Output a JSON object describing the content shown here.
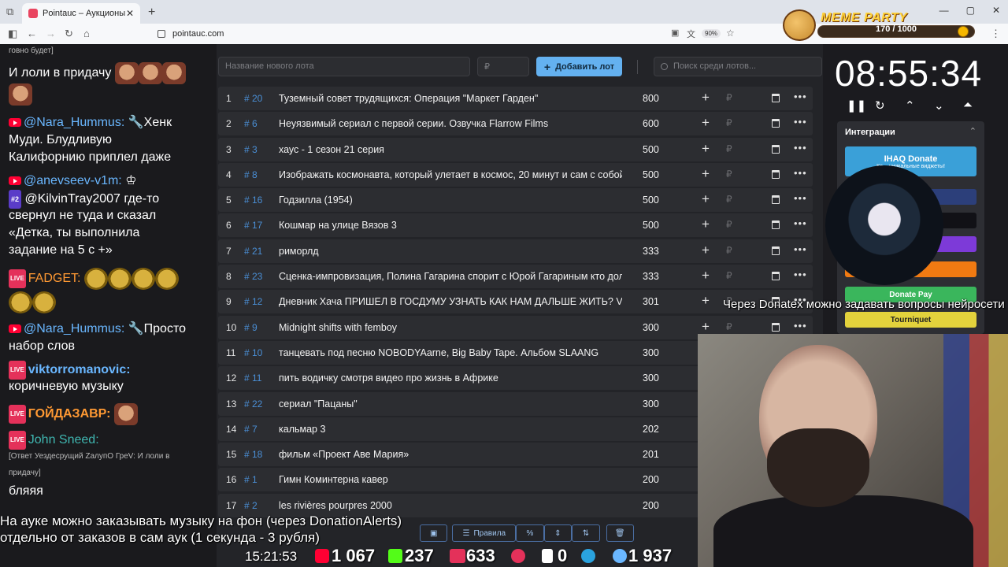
{
  "browser": {
    "tab_title": "Pointauc – Аукционы, лотереи",
    "url": "pointauc.com",
    "zoom": "90%"
  },
  "meme_party": {
    "title": "MEME PARTY",
    "progress": "170 / 1000"
  },
  "chat": {
    "lines": [
      {
        "text": "говно будет]"
      },
      {
        "text": "И лоли в придачу"
      },
      {
        "nick": "@Nara_Hummus:",
        "text": "Хенк"
      },
      {
        "text": "Муди. Блудливую"
      },
      {
        "text": "Калифорнию приплел даже"
      },
      {
        "nick": "@anevseev-v1m:"
      },
      {
        "badge": "#2",
        "text": "@KilvinTray2007 где-то"
      },
      {
        "text": "свернул не туда и сказал"
      },
      {
        "text": "«Детка, ты выполнила"
      },
      {
        "text": "задание на 5 с +»"
      },
      {
        "nick": "FADGET:"
      },
      {
        "nick": "@Nara_Hummus:",
        "text": "Просто"
      },
      {
        "text": "набор слов"
      },
      {
        "nick": "viktorromanovic:"
      },
      {
        "text": "коричневую музыку"
      },
      {
        "nick": "ГОЙДАЗАВР:"
      },
      {
        "nick": "John Sneed:"
      },
      {
        "text": "[Ответ Уездесрущий ZалупО ГреV: И лоли в"
      },
      {
        "text": "придачу]"
      },
      {
        "text": "бляяя"
      }
    ]
  },
  "app": {
    "new_lot_placeholder": "Название нового лота",
    "price_placeholder": "₽",
    "add_button": "Добавить лот",
    "search_placeholder": "Поиск среди лотов...",
    "rows": [
      {
        "idx": "1",
        "num": "# 20",
        "name": "Туземный совет трудящихся: Операция \"Маркет Гарден\"",
        "amount": "800"
      },
      {
        "idx": "2",
        "num": "# 6",
        "name": "Неуязвимый сериал с первой серии. Озвучка Flarrow Films",
        "amount": "600"
      },
      {
        "idx": "3",
        "num": "# 3",
        "name": "хаус - 1 сезон 21 серия",
        "amount": "500"
      },
      {
        "idx": "4",
        "num": "# 8",
        "name": "Изображать космонавта, который улетает в космос, 20 минут и сам с собой",
        "amount": "500"
      },
      {
        "idx": "5",
        "num": "# 16",
        "name": "Годзилла (1954)",
        "amount": "500"
      },
      {
        "idx": "6",
        "num": "# 17",
        "name": "Кошмар на улице Вязов 3",
        "amount": "500"
      },
      {
        "idx": "7",
        "num": "# 21",
        "name": "риморлд",
        "amount": "333"
      },
      {
        "idx": "8",
        "num": "# 23",
        "name": "Сценка-импровизация, Полина Гагарина спорит с Юрой Гагариным кто должен",
        "amount": "333"
      },
      {
        "idx": "9",
        "num": "# 12",
        "name": "Дневник Хача ПРИШЕЛ В ГОСДУМУ УЗНАТЬ КАК НАМ ДАЛЬШЕ ЖИТЬ? VS",
        "amount": "301"
      },
      {
        "idx": "10",
        "num": "# 9",
        "name": "Midnight shifts with femboy",
        "amount": "300"
      },
      {
        "idx": "11",
        "num": "# 10",
        "name": "танцевать под песню NOBODYAarne, Big Baby Tape. Альбом SLAANG",
        "amount": "300"
      },
      {
        "idx": "12",
        "num": "# 11",
        "name": "пить водичку смотря видео про жизнь в Африке",
        "amount": "300"
      },
      {
        "idx": "13",
        "num": "# 22",
        "name": "сериал \"Пацаны\"",
        "amount": "300"
      },
      {
        "idx": "14",
        "num": "# 7",
        "name": "кальмар 3",
        "amount": "202"
      },
      {
        "idx": "15",
        "num": "# 18",
        "name": "фильм «Проект Аве Мария»",
        "amount": "201"
      },
      {
        "idx": "16",
        "num": "# 1",
        "name": "Гимн Коминтерна кавер",
        "amount": "200"
      },
      {
        "idx": "17",
        "num": "# 2",
        "name": "les rivières pourpres 2000",
        "amount": "200"
      }
    ],
    "rules_button": "Правила"
  },
  "timer": {
    "value": "08:55:34"
  },
  "integrations": {
    "title": "Интеграции",
    "buttons": [
      {
        "label": "IHAQ Donate",
        "sub": "Ко... уникальные виджеты!",
        "color": "#3aa0d8"
      },
      {
        "label": "...er",
        "color": "#2c3f7a"
      },
      {
        "label": "",
        "color": "#111116"
      },
      {
        "label": "",
        "color": "#7d3ad8"
      },
      {
        "label": "...lerts",
        "color": "#f07a12"
      },
      {
        "label": "Donate Pay",
        "color": "#3ab65c"
      },
      {
        "label": "Tourniquet",
        "color": "#e3d23c"
      }
    ]
  },
  "overlay": {
    "donatex": "Через Donatex можно задавать вопросы нейросети",
    "music_line1": "На ауке можно заказывать музыку на фон (через DonationAlerts)",
    "music_line2": "отдельно от заказов в сам аук (1 секунда - 3 рубля)",
    "clock": "15:21:53",
    "stats": [
      "1 067",
      "237",
      "633",
      "0",
      "1 937"
    ]
  }
}
